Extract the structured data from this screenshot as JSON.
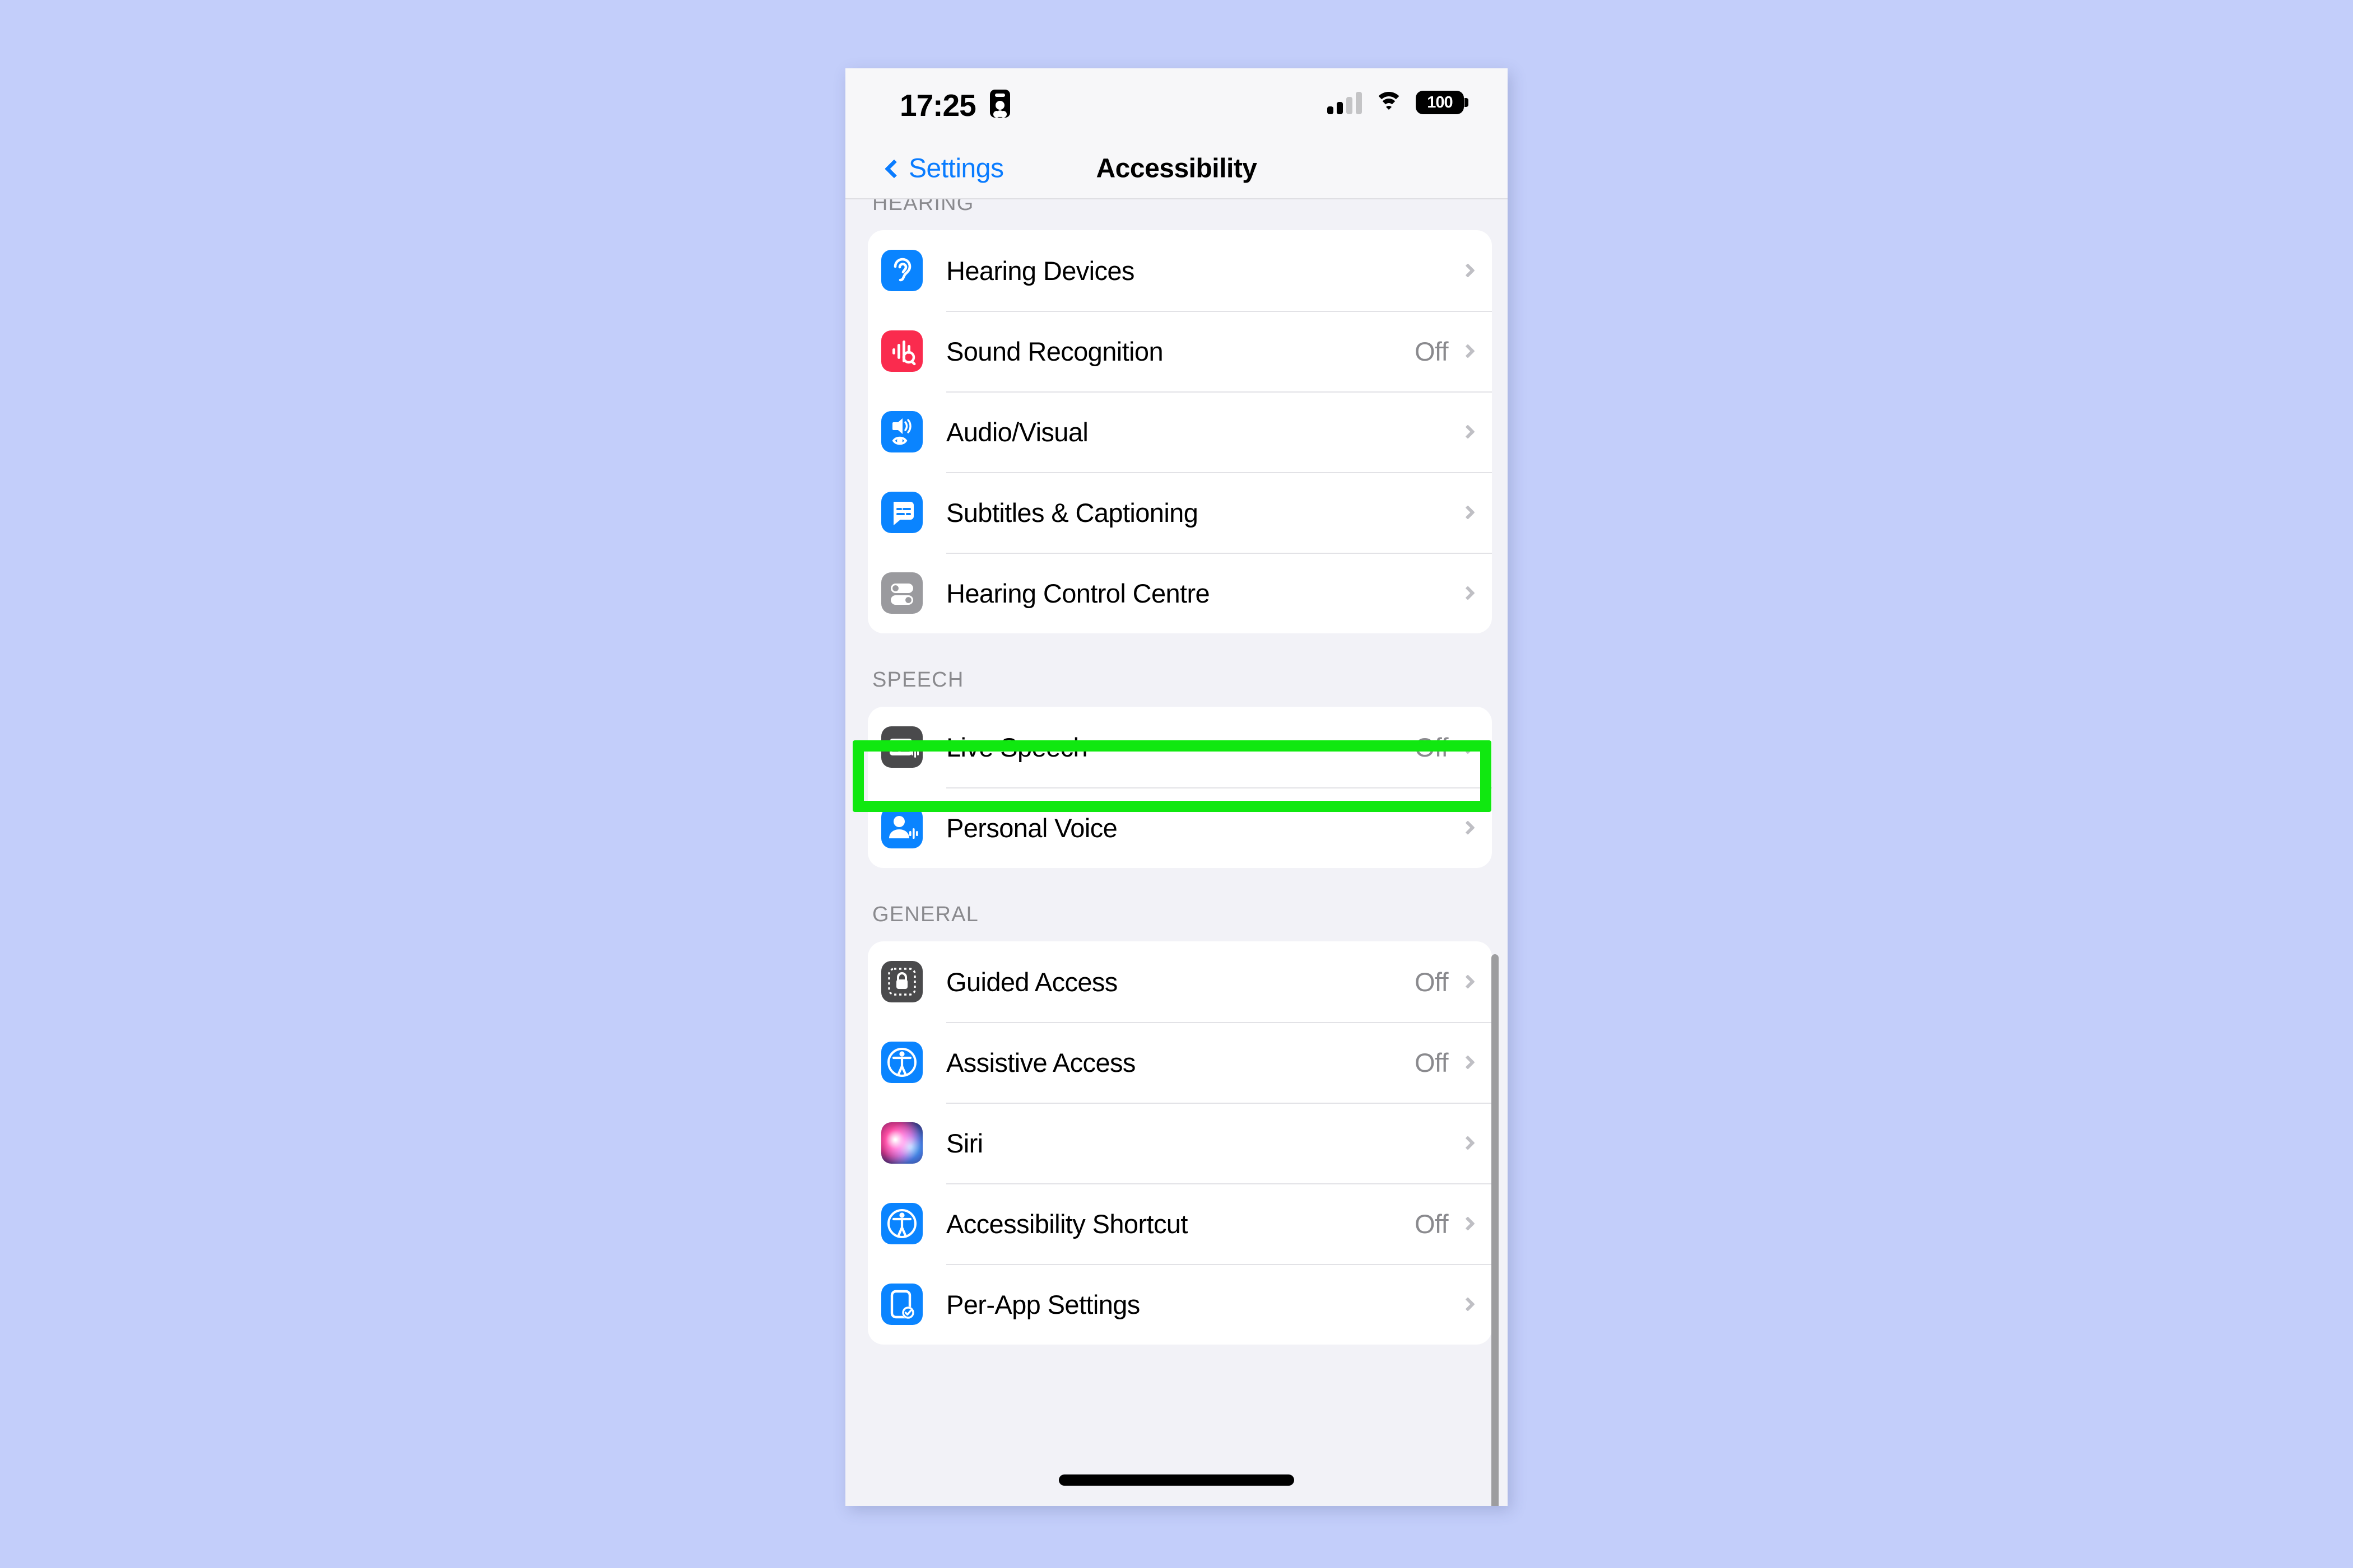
{
  "background_color": "#c3cefa",
  "status_bar": {
    "time": "17:25",
    "focus_icon": "id-badge-icon",
    "signal_icon": "cellular-signal-icon",
    "wifi_icon": "wifi-icon",
    "battery_level": "100"
  },
  "nav": {
    "back_label": "Settings",
    "back_icon": "chevron-left-icon",
    "title": "Accessibility"
  },
  "sections": [
    {
      "header": "HEARING",
      "rows": [
        {
          "label": "Hearing Devices",
          "value": "",
          "icon": "ear-icon",
          "icon_color": "#0a84ff"
        },
        {
          "label": "Sound Recognition",
          "value": "Off",
          "icon": "waveform-magnifier-icon",
          "icon_color": "#fa2b4e"
        },
        {
          "label": "Audio/Visual",
          "value": "",
          "icon": "speaker-eye-icon",
          "icon_color": "#0a84ff"
        },
        {
          "label": "Subtitles & Captioning",
          "value": "",
          "icon": "caption-bubble-icon",
          "icon_color": "#0a84ff"
        },
        {
          "label": "Hearing Control Centre",
          "value": "",
          "icon": "toggles-icon",
          "icon_color": "#9a9a9e"
        }
      ]
    },
    {
      "header": "SPEECH",
      "rows": [
        {
          "label": "Live Speech",
          "value": "Off",
          "icon": "keyboard-waveform-icon",
          "icon_color": "#4a4a4c",
          "highlighted": true
        },
        {
          "label": "Personal Voice",
          "value": "",
          "icon": "person-waveform-icon",
          "icon_color": "#0a84ff"
        }
      ]
    },
    {
      "header": "GENERAL",
      "rows": [
        {
          "label": "Guided Access",
          "value": "Off",
          "icon": "lock-dotted-icon",
          "icon_color": "#4a4a4c"
        },
        {
          "label": "Assistive Access",
          "value": "Off",
          "icon": "accessibility-icon",
          "icon_color": "#0a84ff"
        },
        {
          "label": "Siri",
          "value": "",
          "icon": "siri-orb-icon",
          "icon_color": "gradient"
        },
        {
          "label": "Accessibility Shortcut",
          "value": "Off",
          "icon": "accessibility-icon",
          "icon_color": "#0a84ff"
        },
        {
          "label": "Per-App Settings",
          "value": "",
          "icon": "device-check-icon",
          "icon_color": "#0a84ff"
        }
      ]
    }
  ],
  "highlight": {
    "color": "#10e810",
    "target": "Live Speech"
  },
  "scrollbar": {
    "visible": true
  },
  "home_indicator": {
    "visible": true
  }
}
